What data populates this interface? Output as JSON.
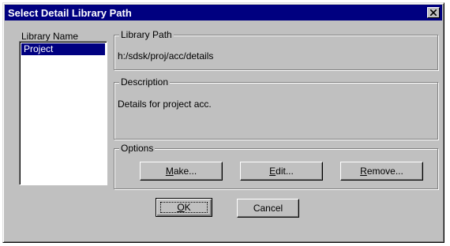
{
  "background": {
    "glyph_upper": "y",
    "glyph_lower": "y",
    "glyph_bottom": ","
  },
  "dialog": {
    "title": "Select Detail Library Path",
    "library_list": {
      "label": "Library Name",
      "items": [
        {
          "label": "Project",
          "selected": true
        }
      ]
    },
    "library_path": {
      "legend": "Library Path",
      "value": "h:/sdsk/proj/acc/details"
    },
    "description": {
      "legend": "Description",
      "value": "Details for project acc."
    },
    "options": {
      "legend": "Options",
      "make": {
        "mnemonic": "M",
        "rest": "ake..."
      },
      "edit": {
        "mnemonic": "E",
        "rest": "dit..."
      },
      "remove": {
        "mnemonic": "R",
        "rest": "emove..."
      }
    },
    "ok": {
      "mnemonic": "O",
      "rest": "K"
    },
    "cancel_label": "Cancel"
  },
  "colors": {
    "face": "#c0c0c0",
    "title_bar": "#000080",
    "selection": "#000080",
    "shadow": "#808080"
  },
  "icons": {
    "close": "close-icon"
  }
}
